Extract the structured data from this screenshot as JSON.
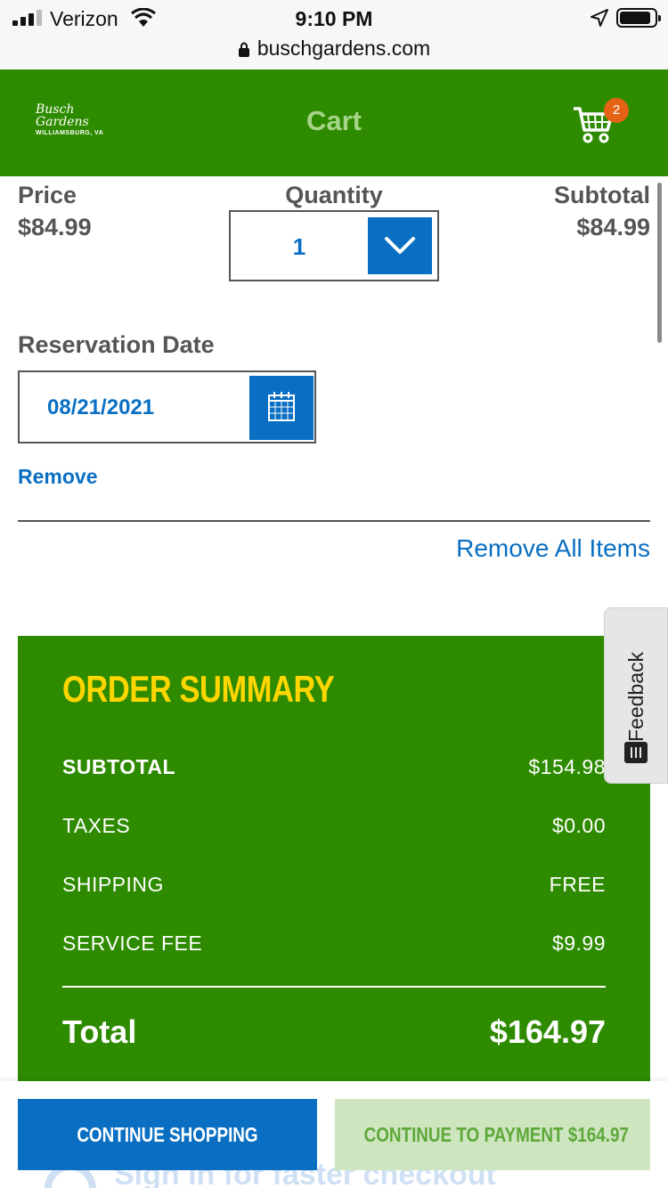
{
  "status_bar": {
    "carrier": "Verizon",
    "time": "9:10 PM"
  },
  "browser": {
    "url": "buschgardens.com"
  },
  "header": {
    "logo_line1": "Busch",
    "logo_line2": "Gardens",
    "logo_location": "WILLIAMSBURG, VA",
    "title": "Cart",
    "cart_count": "2"
  },
  "item": {
    "price_label": "Price",
    "price_value": "$84.99",
    "quantity_label": "Quantity",
    "quantity_value": "1",
    "subtotal_label": "Subtotal",
    "subtotal_value": "$84.99",
    "reservation_label": "Reservation Date",
    "reservation_date": "08/21/2021",
    "remove_label": "Remove"
  },
  "remove_all_label": "Remove All Items",
  "summary": {
    "title": "ORDER SUMMARY",
    "rows": [
      {
        "label": "SUBTOTAL",
        "value": "$154.98"
      },
      {
        "label": "TAXES",
        "value": "$0.00"
      },
      {
        "label": "SHIPPING",
        "value": "FREE"
      },
      {
        "label": "SERVICE FEE",
        "value": "$9.99"
      }
    ],
    "total_label": "Total",
    "total_value": "$164.97"
  },
  "feedback_label": "Feedback",
  "bottom": {
    "continue_label": "CONTINUE SHOPPING",
    "pay_label": "CONTINUE TO PAYMENT $164.97",
    "signin_hint": "Sign in for faster checkout"
  },
  "colors": {
    "brand_green": "#2e8b00",
    "accent_blue": "#0a6fc2",
    "summary_title": "#ffd600",
    "badge": "#e46315"
  }
}
